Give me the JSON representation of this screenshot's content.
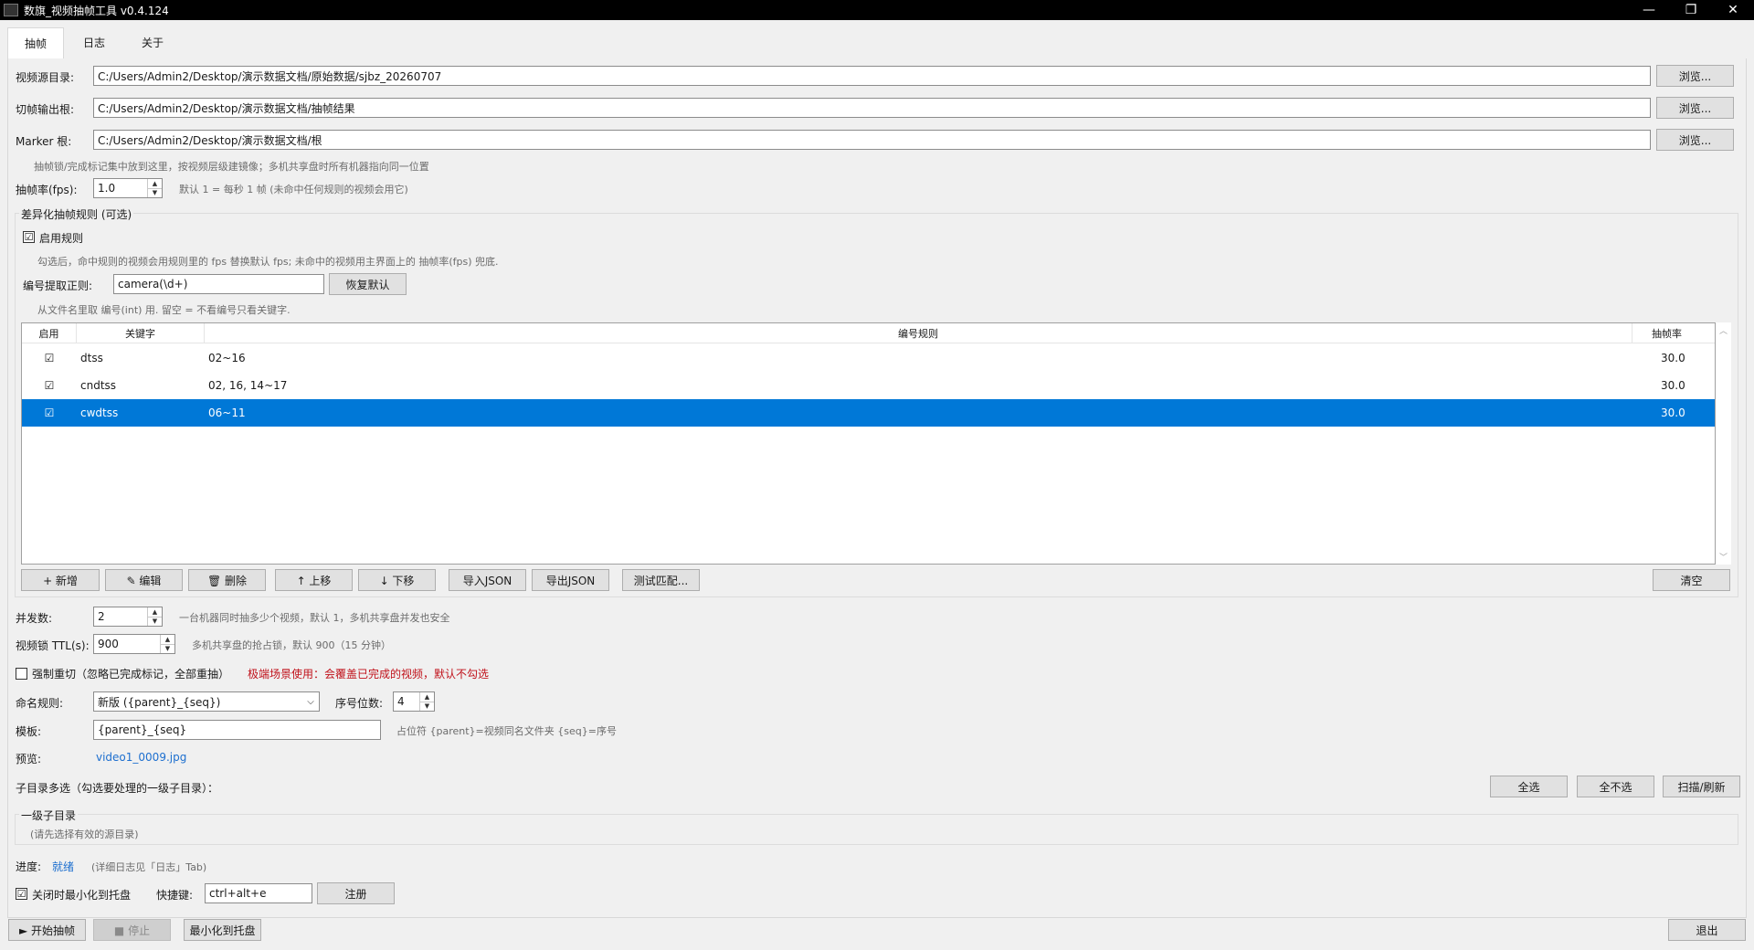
{
  "window": {
    "title": "数旗_视频抽帧工具  v0.4.124",
    "min_icon": "minimize-icon",
    "max_icon": "restore-icon",
    "close_icon": "close-icon"
  },
  "tabs": [
    {
      "label": "抽帧"
    },
    {
      "label": "日志"
    },
    {
      "label": "关于"
    }
  ],
  "paths": {
    "source_label": "视频源目录:",
    "source_value": "C:/Users/Admin2/Desktop/演示数据文档/原始数据/sjbz_20260707",
    "output_label": "切帧输出根:",
    "output_value": "C:/Users/Admin2/Desktop/演示数据文档/抽帧结果",
    "marker_label": "Marker 根:",
    "marker_value": "C:/Users/Admin2/Desktop/演示数据文档/根",
    "browse_label": "浏览...",
    "marker_hint": "抽帧锁/完成标记集中放到这里，按视频层级建镜像；多机共享盘时所有机器指向同一位置"
  },
  "fps": {
    "label": "抽帧率(fps):",
    "value": "1.0",
    "hint": "默认 1 = 每秒 1 帧 (未命中任何规则的视频会用它)"
  },
  "rules": {
    "group_title": "差异化抽帧规则 (可选)",
    "enable_label": "启用规则",
    "enable_checked": "☑",
    "enable_hint": "勾选后，命中规则的视频会用规则里的 fps 替换默认 fps; 未命中的视频用主界面上的 抽帧率(fps) 兜底.",
    "regex_label": "编号提取正则:",
    "regex_value": "camera(\\d+)",
    "restore_label": "恢复默认",
    "regex_hint": "从文件名里取 编号(int) 用. 留空 = 不看编号只看关键字.",
    "columns": [
      "启用",
      "关键字",
      "编号规则",
      "抽帧率"
    ],
    "rows": [
      {
        "enabled": "☑",
        "keyword": "dtss",
        "rule": "02~16",
        "fps": "30.0"
      },
      {
        "enabled": "☑",
        "keyword": "cndtss",
        "rule": "02, 16, 14~17",
        "fps": "30.0"
      },
      {
        "enabled": "☑",
        "keyword": "cwdtss",
        "rule": "06~11",
        "fps": "30.0"
      }
    ],
    "buttons": {
      "add": "+ 新增",
      "edit": "✎ 编辑",
      "delete": "🗑 删除",
      "up": "↑ 上移",
      "down": "↓ 下移",
      "import": "导入JSON",
      "export": "导出JSON",
      "test": "测试匹配...",
      "clear": "清空"
    }
  },
  "concurrency": {
    "label": "并发数:",
    "value": "2",
    "hint": "一台机器同时抽多少个视频，默认 1，多机共享盘并发也安全"
  },
  "ttl": {
    "label": "视频锁 TTL(s):",
    "value": "900",
    "hint": "多机共享盘的抢占锁，默认 900（15 分钟）"
  },
  "force": {
    "label": "强制重切（忽略已完成标记，全部重抽）",
    "warning": "极端场景使用：会覆盖已完成的视频，默认不勾选"
  },
  "naming": {
    "label": "命名规则:",
    "value": "新版 ({parent}_{seq})",
    "digits_label": "序号位数:",
    "digits_value": "4"
  },
  "template": {
    "label": "模板:",
    "value": "{parent}_{seq}",
    "hint": "占位符 {parent}=视频同名文件夹  {seq}=序号"
  },
  "preview": {
    "label": "预览:",
    "value": "video1_0009.jpg"
  },
  "subdirs": {
    "label": "子目录多选（勾选要处理的一级子目录）：",
    "select_all": "全选",
    "select_none": "全不选",
    "scan": "扫描/刷新",
    "group_title": "一级子目录",
    "empty_hint": "(请先选择有效的源目录)"
  },
  "progress": {
    "label": "进度:",
    "status": "就绪",
    "hint": "(详细日志见「日志」Tab)"
  },
  "tray": {
    "label": "关闭时最小化到托盘",
    "checked": "☑",
    "hotkey_label": "快捷键:",
    "hotkey_value": "ctrl+alt+e",
    "register": "注册"
  },
  "footer": {
    "start": "► 开始抽帧",
    "stop": "■ 停止",
    "minimize": "最小化到托盘",
    "exit": "退出"
  }
}
